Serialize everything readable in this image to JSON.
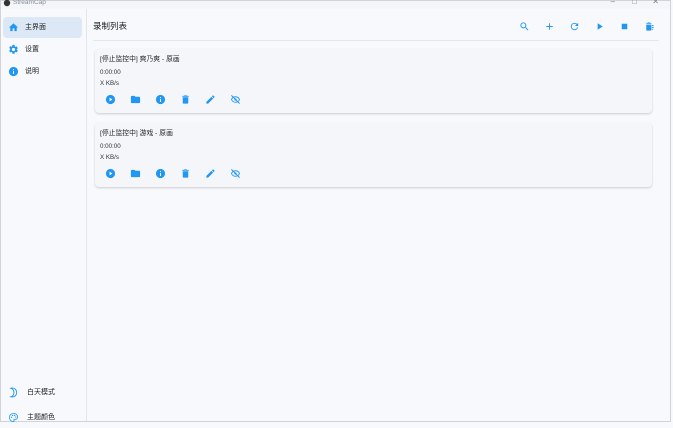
{
  "window": {
    "title": "StreamCap",
    "accent": "#2196f3"
  },
  "sidebar": {
    "items": [
      {
        "label": "主界面",
        "icon": "home-icon",
        "active": true
      },
      {
        "label": "设置",
        "icon": "gear-icon",
        "active": false
      },
      {
        "label": "说明",
        "icon": "info-icon",
        "active": false
      }
    ],
    "bottom": [
      {
        "label": "白天模式",
        "icon": "moon-icon"
      },
      {
        "label": "主题颜色",
        "icon": "palette-icon"
      }
    ]
  },
  "header": {
    "title": "录制列表",
    "actions": [
      "search-icon",
      "add-icon",
      "refresh-icon",
      "play-icon",
      "stop-icon",
      "delete-all-icon"
    ]
  },
  "recordings": [
    {
      "title": "[停止监控中] 爽乃爽 - 原画",
      "duration": "0:00:00",
      "speed": "X KB/s"
    },
    {
      "title": "[停止监控中] 游戏 - 原画",
      "duration": "0:00:00",
      "speed": "X KB/s"
    }
  ]
}
